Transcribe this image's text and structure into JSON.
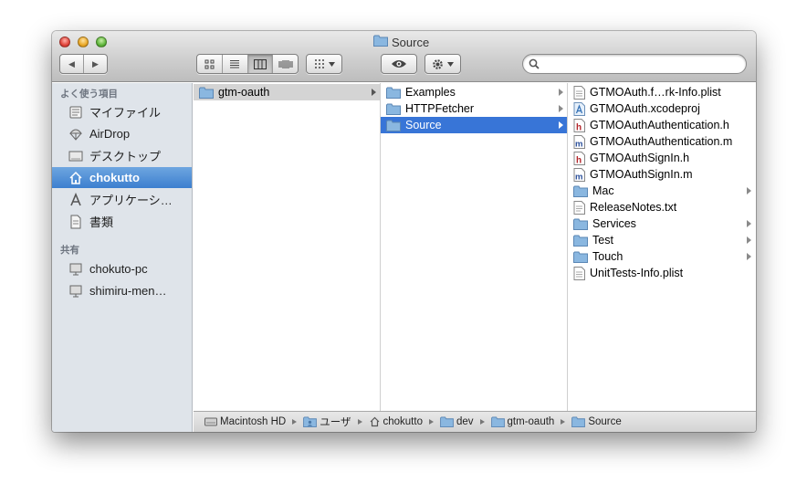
{
  "window": {
    "title": "Source"
  },
  "toolbar": {
    "back_label": "◀",
    "forward_label": "▶",
    "search_placeholder": ""
  },
  "sidebar": {
    "favorites_header": "よく使う項目",
    "favorites": [
      {
        "label": "マイファイル",
        "icon": "all-my-files-icon"
      },
      {
        "label": "AirDrop",
        "icon": "airdrop-icon"
      },
      {
        "label": "デスクトップ",
        "icon": "desktop-icon"
      },
      {
        "label": "chokutto",
        "icon": "home-icon",
        "selected": true
      },
      {
        "label": "アプリケーシ…",
        "icon": "applications-icon"
      },
      {
        "label": "書類",
        "icon": "documents-icon"
      }
    ],
    "shared_header": "共有",
    "shared": [
      {
        "label": "chokuto-pc",
        "icon": "computer-icon"
      },
      {
        "label": "shimiru-men…",
        "icon": "computer-icon"
      }
    ]
  },
  "columns": [
    {
      "items": [
        {
          "label": "gtm-oauth",
          "kind": "folder",
          "state": "selected-inactive",
          "arrow": true
        }
      ]
    },
    {
      "items": [
        {
          "label": "Examples",
          "kind": "folder",
          "arrow": true
        },
        {
          "label": "HTTPFetcher",
          "kind": "folder",
          "arrow": true
        },
        {
          "label": "Source",
          "kind": "folder",
          "state": "selected",
          "arrow": true
        }
      ]
    },
    {
      "items": [
        {
          "label": "GTMOAuth.f…rk-Info.plist",
          "kind": "plist"
        },
        {
          "label": "GTMOAuth.xcodeproj",
          "kind": "xcodeproj"
        },
        {
          "label": "GTMOAuthAuthentication.h",
          "kind": "h"
        },
        {
          "label": "GTMOAuthAuthentication.m",
          "kind": "m"
        },
        {
          "label": "GTMOAuthSignIn.h",
          "kind": "h"
        },
        {
          "label": "GTMOAuthSignIn.m",
          "kind": "m"
        },
        {
          "label": "Mac",
          "kind": "folder",
          "arrow": true
        },
        {
          "label": "ReleaseNotes.txt",
          "kind": "txt"
        },
        {
          "label": "Services",
          "kind": "folder",
          "arrow": true
        },
        {
          "label": "Test",
          "kind": "folder",
          "arrow": true
        },
        {
          "label": "Touch",
          "kind": "folder",
          "arrow": true
        },
        {
          "label": "UnitTests-Info.plist",
          "kind": "plist"
        }
      ]
    }
  ],
  "pathbar": [
    {
      "label": "Macintosh HD",
      "icon": "hard-drive-icon"
    },
    {
      "label": "ユーザ",
      "icon": "users-folder-icon"
    },
    {
      "label": "chokutto",
      "icon": "home-icon"
    },
    {
      "label": "dev",
      "icon": "folder-icon"
    },
    {
      "label": "gtm-oauth",
      "icon": "folder-icon"
    },
    {
      "label": "Source",
      "icon": "folder-icon"
    }
  ],
  "colors": {
    "selection": "#3875d7",
    "sidebar_bg": "#dfe4ea",
    "folder": "#8ab7e0"
  }
}
